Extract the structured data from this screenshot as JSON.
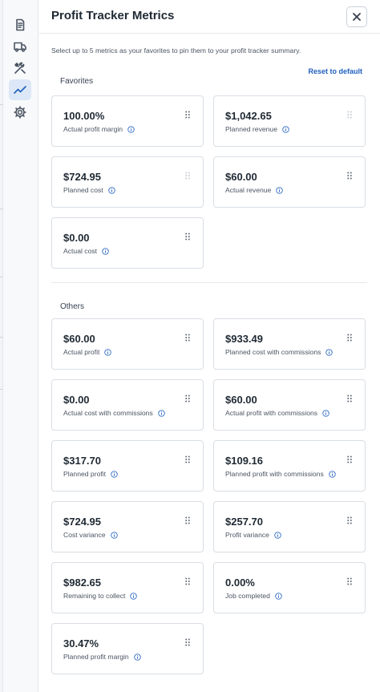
{
  "panel": {
    "title": "Profit Tracker Metrics",
    "description": "Select up to 5 metrics as your favorites to pin them to your profit tracker summary.",
    "reset_label": "Reset to default"
  },
  "sidebar": {
    "icons": [
      "document-icon",
      "truck-icon",
      "tools-icon",
      "trend-line-icon",
      "gear-icon"
    ],
    "active_index": 3
  },
  "colors": {
    "accent": "#1f5fbf",
    "active_bg": "#dce8f7"
  },
  "sections": {
    "favorites_title": "Favorites",
    "others_title": "Others"
  },
  "favorites": [
    {
      "value": "100.00%",
      "label": "Actual profit margin"
    },
    {
      "value": "$1,042.65",
      "label": "Planned revenue"
    },
    {
      "value": "$724.95",
      "label": "Planned cost"
    },
    {
      "value": "$60.00",
      "label": "Actual revenue"
    },
    {
      "value": "$0.00",
      "label": "Actual cost"
    }
  ],
  "others": [
    {
      "value": "$60.00",
      "label": "Actual profit"
    },
    {
      "value": "$933.49",
      "label": "Planned cost with commissions"
    },
    {
      "value": "$0.00",
      "label": "Actual cost with commissions"
    },
    {
      "value": "$60.00",
      "label": "Actual profit with commissions"
    },
    {
      "value": "$317.70",
      "label": "Planned profit"
    },
    {
      "value": "$109.16",
      "label": "Planned profit with commissions"
    },
    {
      "value": "$724.95",
      "label": "Cost variance"
    },
    {
      "value": "$257.70",
      "label": "Profit variance"
    },
    {
      "value": "$982.65",
      "label": "Remaining to collect"
    },
    {
      "value": "0.00%",
      "label": "Job completed"
    },
    {
      "value": "30.47%",
      "label": "Planned profit margin"
    }
  ]
}
